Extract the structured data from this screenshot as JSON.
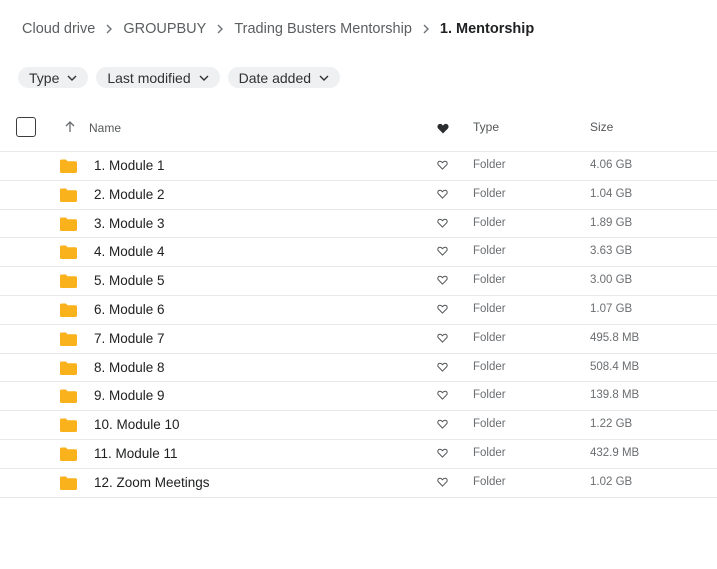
{
  "breadcrumb": [
    {
      "label": "Cloud drive"
    },
    {
      "label": "GROUPBUY"
    },
    {
      "label": "Trading Busters Mentorship"
    },
    {
      "label": "1. Mentorship"
    }
  ],
  "filters": [
    {
      "label": "Type"
    },
    {
      "label": "Last modified"
    },
    {
      "label": "Date added"
    }
  ],
  "columns": {
    "name": "Name",
    "type": "Type",
    "size": "Size"
  },
  "colors": {
    "folder": "#f9b21c",
    "text": "#202122",
    "muted": "#6a6d70",
    "divider": "#e6e8e9",
    "chip_bg": "#eef0f1"
  },
  "rows": [
    {
      "name": "1. Module 1",
      "type": "Folder",
      "size": "4.06 GB"
    },
    {
      "name": "2. Module 2",
      "type": "Folder",
      "size": "1.04 GB"
    },
    {
      "name": "3. Module 3",
      "type": "Folder",
      "size": "1.89 GB"
    },
    {
      "name": "4. Module 4",
      "type": "Folder",
      "size": "3.63 GB"
    },
    {
      "name": "5. Module 5",
      "type": "Folder",
      "size": "3.00 GB"
    },
    {
      "name": "6. Module 6",
      "type": "Folder",
      "size": "1.07 GB"
    },
    {
      "name": "7. Module 7",
      "type": "Folder",
      "size": "495.8 MB"
    },
    {
      "name": "8. Module 8",
      "type": "Folder",
      "size": "508.4 MB"
    },
    {
      "name": "9. Module 9",
      "type": "Folder",
      "size": "139.8 MB"
    },
    {
      "name": "10. Module 10",
      "type": "Folder",
      "size": "1.22 GB"
    },
    {
      "name": "11. Module 11",
      "type": "Folder",
      "size": "432.9 MB"
    },
    {
      "name": "12. Zoom Meetings",
      "type": "Folder",
      "size": "1.02 GB"
    }
  ]
}
